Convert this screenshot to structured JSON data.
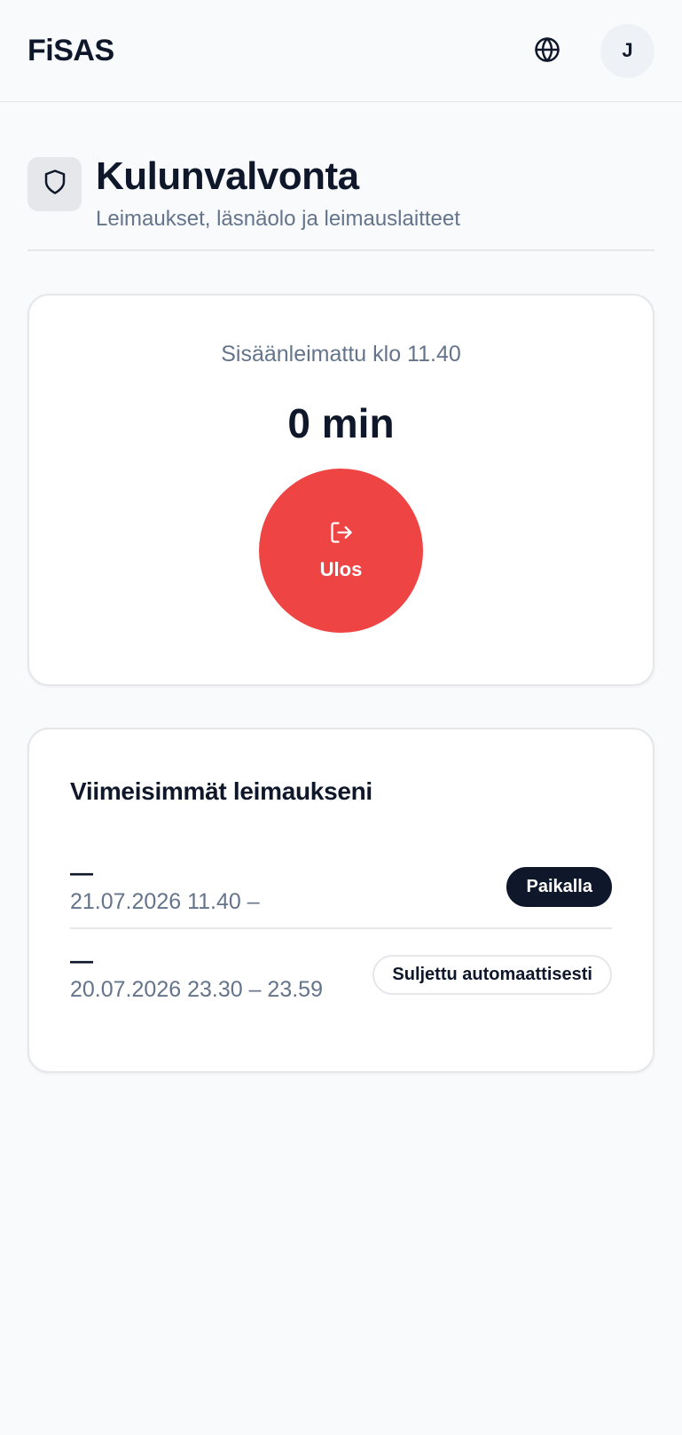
{
  "app": {
    "brand": "FiSAS",
    "avatar_initial": "J",
    "icons": {
      "language": "globe-icon",
      "header": "shield-icon",
      "clockout": "log-out-icon"
    }
  },
  "page": {
    "title": "Kulunvalvonta",
    "subtitle": "Leimaukset, läsnäolo ja leimauslaitteet"
  },
  "clock": {
    "status": "Sisäänleimattu klo 11.40",
    "duration": "0 min",
    "button_label": "Ulos",
    "button_color": "#ef4444"
  },
  "recent": {
    "title": "Viimeisimmät leimaukseni",
    "entries": [
      {
        "label": "—",
        "time": "21.07.2026 11.40 –",
        "status": "Paikalla"
      },
      {
        "label": "—",
        "time": "20.07.2026 23.30 – 23.59",
        "status": "Suljettu automaattisesti"
      }
    ]
  }
}
